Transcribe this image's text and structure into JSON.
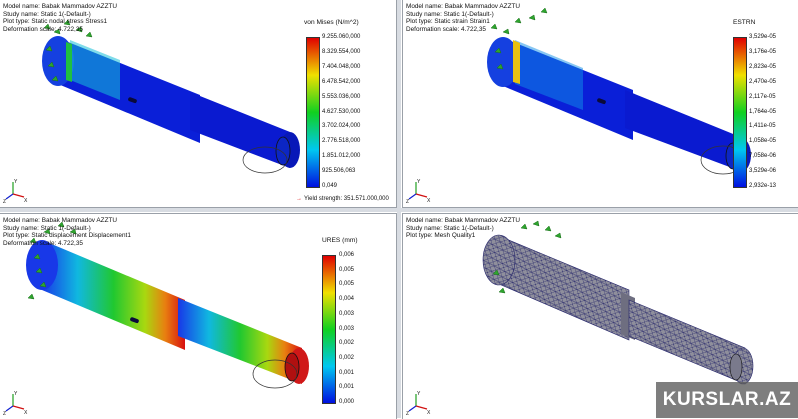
{
  "viewports": [
    {
      "model_name": "Model name: Babak Mammadov  AZZTU",
      "study_name": "Study name: Static 1(-Default-)",
      "plot_type": "Plot type: Static nodal stress Stress1",
      "deformation": "Deformation scale: 4.722,35",
      "legend_title": "von Mises (N/m^2)",
      "legend_ticks": [
        "9.255.060,000",
        "8.329.554,000",
        "7.404.048,000",
        "6.478.542,000",
        "5.553.036,000",
        "4.627.530,000",
        "3.702.024,000",
        "2.776.518,000",
        "1.851.012,000",
        "925.506,063",
        "0,049"
      ],
      "yield_strength": "Yield strength: 351.571.000,000"
    },
    {
      "model_name": "Model name: Babak Mammadov  AZZTU",
      "study_name": "Study name: Static 1(-Default-)",
      "plot_type": "Plot type: Static strain Strain1",
      "deformation": "Deformation scale: 4.722,35",
      "legend_title": "ESTRN",
      "legend_ticks": [
        "3,529e-05",
        "3,176e-05",
        "2,823e-05",
        "2,470e-05",
        "2,117e-05",
        "1,764e-05",
        "1,411e-05",
        "1,058e-05",
        "7,058e-06",
        "3,529e-06",
        "2,932e-13"
      ]
    },
    {
      "model_name": "Model name: Babak Mammadov  AZZTU",
      "study_name": "Study name: Static 1(-Default-)",
      "plot_type": "Plot type: Static displacement Displacement1",
      "deformation": "Deformation scale: 4.722,35",
      "legend_title": "URES (mm)",
      "legend_ticks": [
        "0,006",
        "0,005",
        "0,005",
        "0,004",
        "0,003",
        "0,003",
        "0,002",
        "0,002",
        "0,001",
        "0,001",
        "0,000"
      ]
    },
    {
      "model_name": "Model name: Babak Mammadov  AZZTU",
      "study_name": "Study name: Static 1(-Default-)",
      "plot_type": "Plot type: Mesh Quality1"
    }
  ],
  "triad_labels": {
    "x": "X",
    "y": "Y",
    "z": "Z"
  },
  "watermark": "KURSLAR.AZ",
  "colors": {
    "blue": "#0a1bd6",
    "red": "#e01010",
    "mesh_fill": "#8f8f9c",
    "mesh_line": "#25256a",
    "fixture_green": "#2ea42e"
  }
}
